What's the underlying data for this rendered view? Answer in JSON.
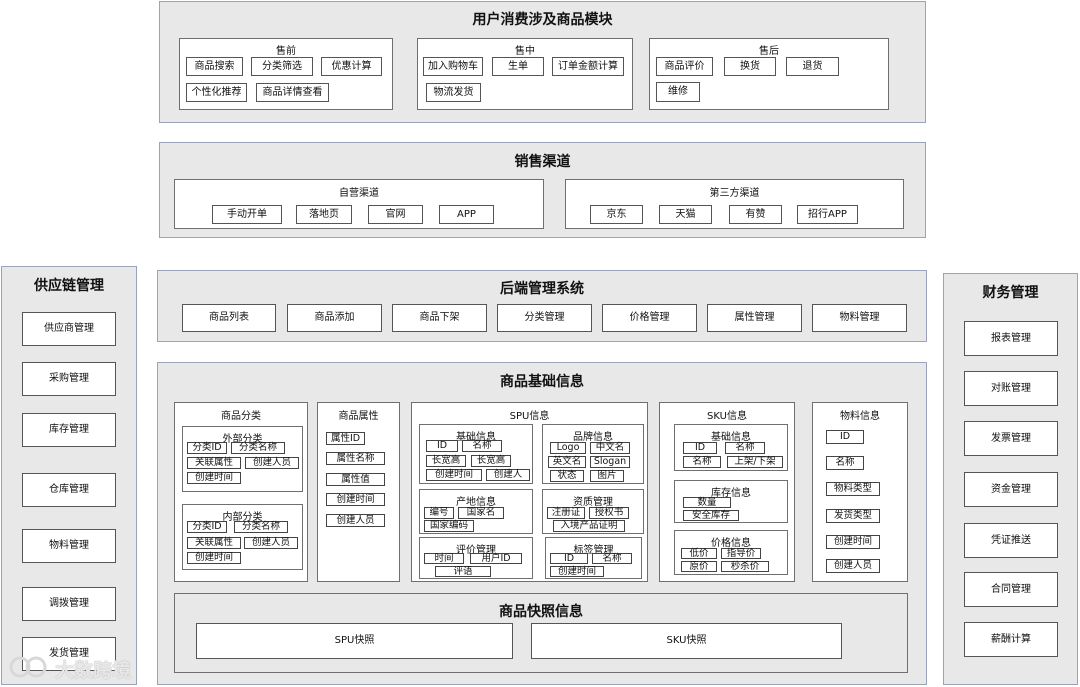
{
  "user_module": {
    "title": "用户消费涉及商品模块",
    "pre": {
      "title": "售前",
      "items": [
        "商品搜索",
        "分类筛选",
        "优惠计算",
        "个性化推荐",
        "商品详情查看"
      ]
    },
    "mid": {
      "title": "售中",
      "items": [
        "加入购物车",
        "生单",
        "订单金额计算",
        "物流发货"
      ]
    },
    "post": {
      "title": "售后",
      "items": [
        "商品评价",
        "换货",
        "退货",
        "维修"
      ]
    }
  },
  "sales_channel": {
    "title": "销售渠道",
    "self": {
      "title": "自营渠道",
      "items": [
        "手动开单",
        "落地页",
        "官网",
        "APP"
      ]
    },
    "third": {
      "title": "第三方渠道",
      "items": [
        "京东",
        "天猫",
        "有赞",
        "招行APP"
      ]
    }
  },
  "backend": {
    "title": "后端管理系统",
    "items": [
      "商品列表",
      "商品添加",
      "商品下架",
      "分类管理",
      "价格管理",
      "属性管理",
      "物料管理"
    ]
  },
  "supply_chain": {
    "title": "供应链管理",
    "items": [
      "供应商管理",
      "采购管理",
      "库存管理",
      "仓库管理",
      "物料管理",
      "调拨管理",
      "发货管理"
    ]
  },
  "finance": {
    "title": "财务管理",
    "items": [
      "报表管理",
      "对账管理",
      "发票管理",
      "资金管理",
      "凭证推送",
      "合同管理",
      "薪酬计算"
    ]
  },
  "base_info": {
    "title": "商品基础信息",
    "category": {
      "title": "商品分类",
      "external": {
        "title": "外部分类",
        "items": [
          "分类ID",
          "分类名称",
          "关联属性",
          "创建人员",
          "创建时间"
        ]
      },
      "internal": {
        "title": "内部分类",
        "items": [
          "分类ID",
          "分类名称",
          "关联属性",
          "创建人员",
          "创建时间"
        ]
      }
    },
    "attribute": {
      "title": "商品属性",
      "items": [
        "属性ID",
        "属性名称",
        "属性值",
        "创建时间",
        "创建人员"
      ]
    },
    "spu": {
      "title": "SPU信息",
      "basic": {
        "title": "基础信息",
        "items": [
          "ID",
          "名称",
          "长宽高",
          "长宽高",
          "创建时间",
          "创建人"
        ]
      },
      "brand": {
        "title": "品牌信息",
        "items": [
          "Logo",
          "中文名",
          "英文名",
          "Slogan",
          "状态",
          "图片"
        ]
      },
      "origin": {
        "title": "产地信息",
        "items": [
          "编号",
          "国家名",
          "国家编码"
        ]
      },
      "qualify": {
        "title": "资质管理",
        "items": [
          "注册证",
          "授权书",
          "入境产品证明"
        ]
      },
      "review": {
        "title": "评价管理",
        "items": [
          "时间",
          "用户ID",
          "评语"
        ]
      },
      "label": {
        "title": "标签管理",
        "items": [
          "ID",
          "名称",
          "创建时间"
        ]
      }
    },
    "sku": {
      "title": "SKU信息",
      "basic": {
        "title": "基础信息",
        "items": [
          "ID",
          "名称",
          "名称",
          "上架/下架"
        ]
      },
      "stock": {
        "title": "库存信息",
        "items": [
          "数量",
          "安全库存"
        ]
      },
      "price": {
        "title": "价格信息",
        "items": [
          "低价",
          "指导价",
          "原价",
          "秒杀价"
        ]
      }
    },
    "material": {
      "title": "物料信息",
      "items": [
        "ID",
        "名称",
        "物料类型",
        "发货类型",
        "创建时间",
        "创建人员"
      ]
    },
    "snapshot": {
      "title": "商品快照信息",
      "items": [
        "SPU快照",
        "SKU快照"
      ]
    }
  },
  "watermark": {
    "text": "大数跨境"
  }
}
